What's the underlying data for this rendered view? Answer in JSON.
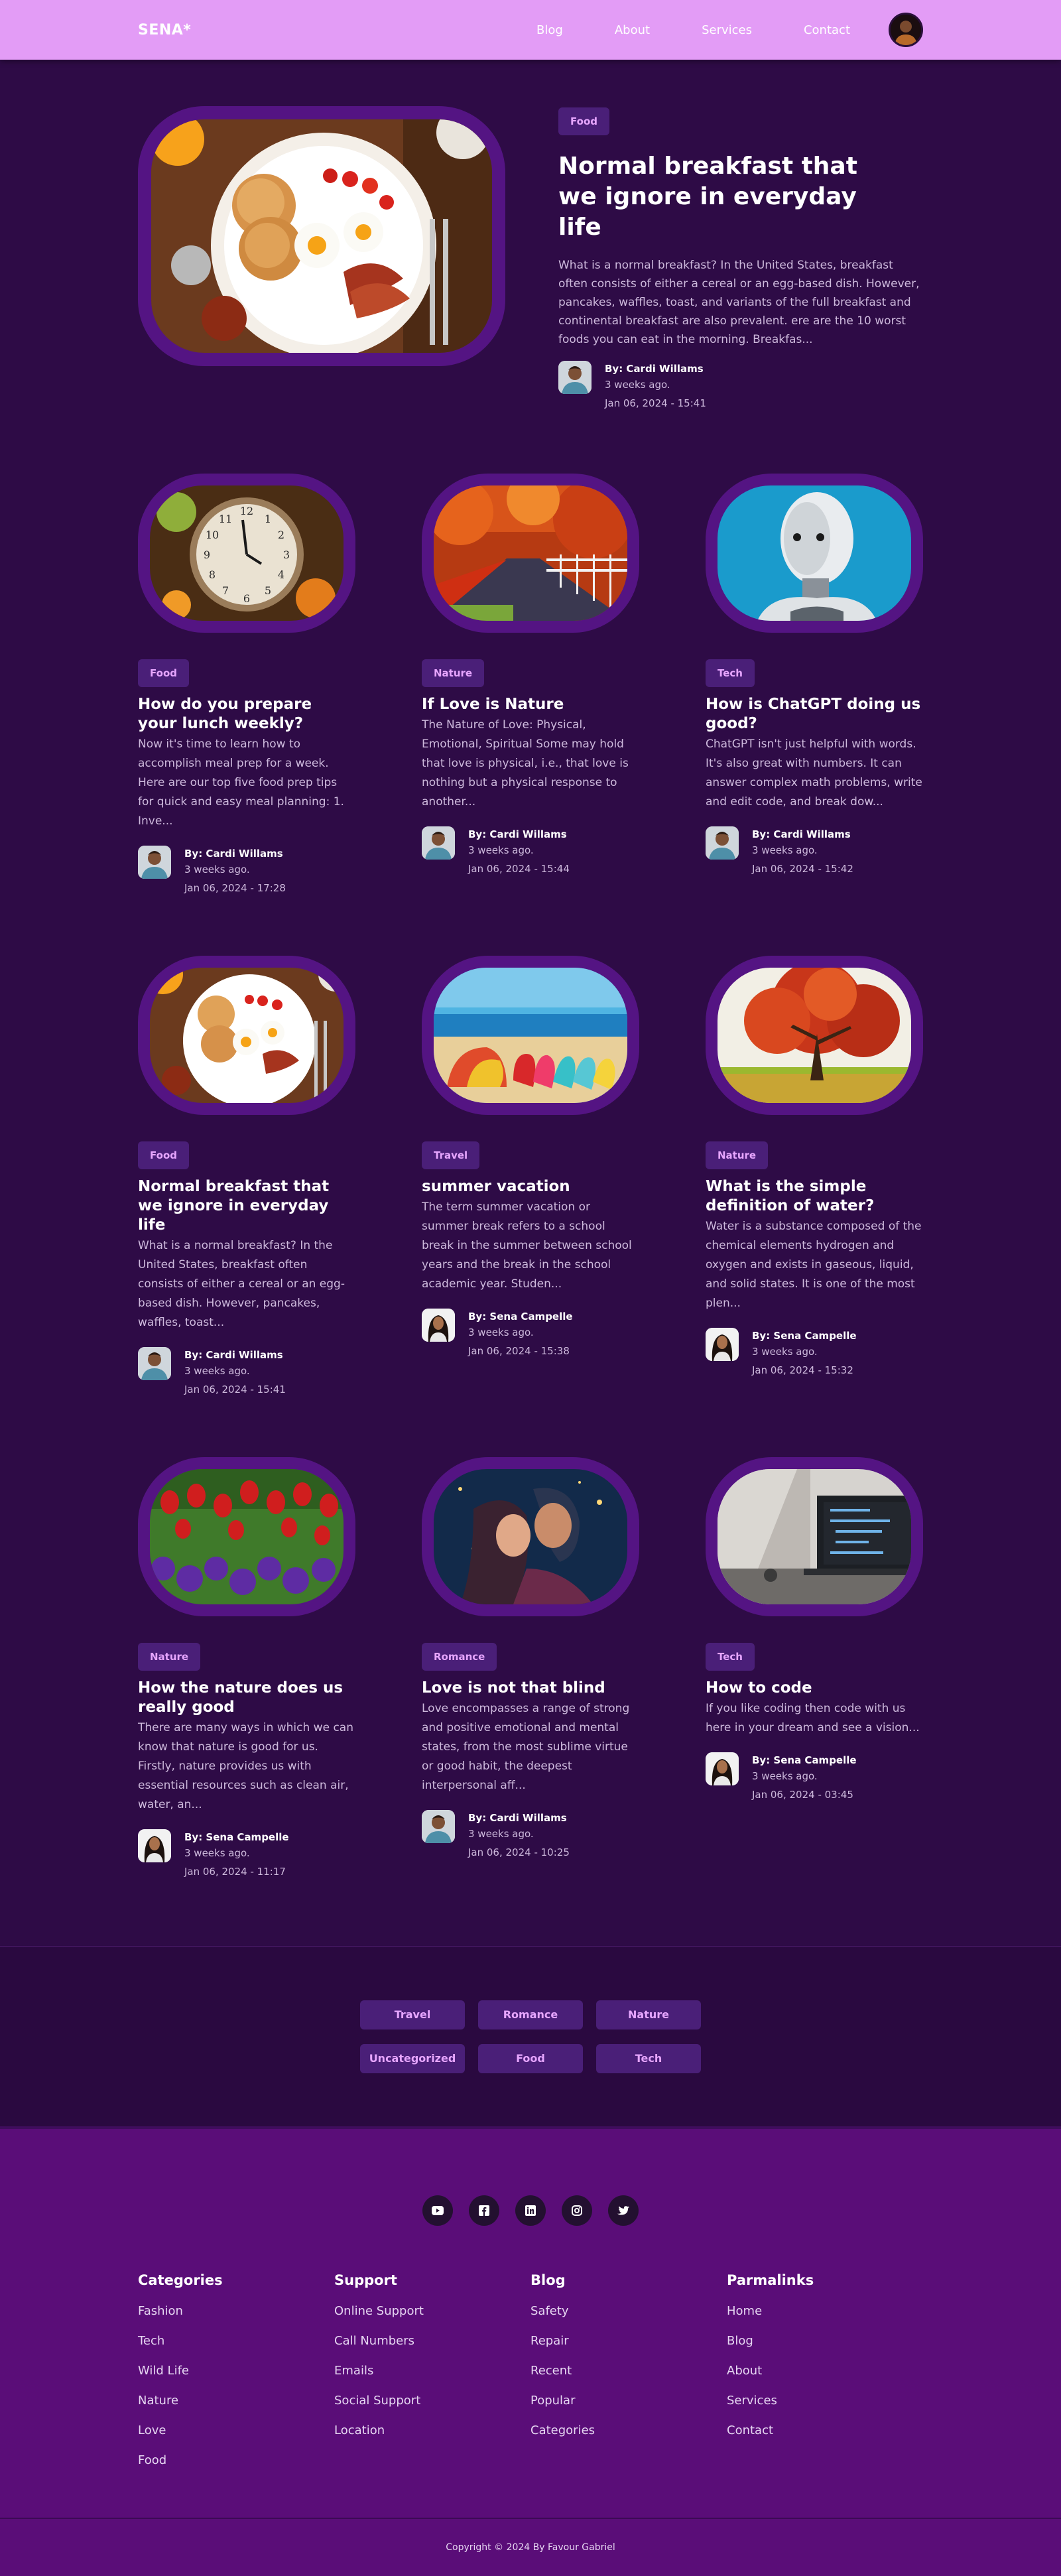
{
  "header": {
    "logo": "SENA*",
    "nav": [
      "Blog",
      "About",
      "Services",
      "Contact"
    ]
  },
  "featured": {
    "tag": "Food",
    "title": "Normal breakfast that we ignore in everyday life",
    "excerpt": "What is a normal breakfast? In the United States, breakfast often consists of either a cereal or an egg-based dish. However, pancakes, waffles, toast, and variants of the full breakfast and continental breakfast are also prevalent. ere are the 10 worst foods you can eat in the morning. Breakfas...",
    "author": "By: Cardi Willams",
    "ago": "3 weeks ago.",
    "date": "Jan 06, 2024 - 15:41"
  },
  "posts": [
    {
      "tag": "Food",
      "title": "How do you prepare your lunch weekly?",
      "excerpt": "Now it's time to learn how to accomplish meal prep for a week. Here are our top five food prep tips for quick and easy meal planning: 1. Inve...",
      "author": "By: Cardi Willams",
      "ago": "3 weeks ago.",
      "date": "Jan 06, 2024 - 17:28",
      "image": "clock-image",
      "avatar": "male"
    },
    {
      "tag": "Nature",
      "title": "If Love is Nature",
      "excerpt": "The Nature of Love: Physical, Emotional, Spiritual Some may hold that love is physical, i.e., that love is nothing but a physical response to another...",
      "author": "By: Cardi Willams",
      "ago": "3 weeks ago.",
      "date": "Jan 06, 2024 - 15:44",
      "image": "autumn-road-image",
      "avatar": "male"
    },
    {
      "tag": "Tech",
      "title": "How is ChatGPT doing us good?",
      "excerpt": "ChatGPT isn't just helpful with words. It's also great with numbers. It can answer complex math problems, write and edit code, and break dow...",
      "author": "By: Cardi Willams",
      "ago": "3 weeks ago.",
      "date": "Jan 06, 2024 - 15:42",
      "image": "robot-image",
      "avatar": "male"
    },
    {
      "tag": "Food",
      "title": "Normal breakfast that we ignore in everyday life",
      "excerpt": "What is a normal breakfast? In the United States, breakfast often consists of either a cereal or an egg-based dish. However, pancakes, waffles, toast...",
      "author": "By: Cardi Willams",
      "ago": "3 weeks ago.",
      "date": "Jan 06, 2024 - 15:41",
      "image": "breakfast-image",
      "avatar": "male"
    },
    {
      "tag": "Travel",
      "title": "summer vacation",
      "excerpt": "The term summer vacation or summer break refers to a school break in the summer between school years and the break in the school academic year. Studen...",
      "author": "By: Sena Campelle",
      "ago": "3 weeks ago.",
      "date": "Jan 06, 2024 - 15:38",
      "image": "beach-image",
      "avatar": "female"
    },
    {
      "tag": "Nature",
      "title": "What is the simple definition of water?",
      "excerpt": "Water is a substance composed of the chemical elements hydrogen and oxygen and exists in gaseous, liquid, and solid states. It is one of the most plen...",
      "author": "By: Sena Campelle",
      "ago": "3 weeks ago.",
      "date": "Jan 06, 2024 - 15:32",
      "image": "tree-image",
      "avatar": "female"
    },
    {
      "tag": "Nature",
      "title": "How the nature does us really good",
      "excerpt": "There are many ways in which we can know that nature is good for us. Firstly, nature provides us with essential resources such as clean air, water, an...",
      "author": "By: Sena Campelle",
      "ago": "3 weeks ago.",
      "date": "Jan 06, 2024 - 11:17",
      "image": "tulips-image",
      "avatar": "female"
    },
    {
      "tag": "Romance",
      "title": "Love is not that blind",
      "excerpt": "Love encompasses a range of strong and positive emotional and mental states, from the most sublime virtue or good habit, the deepest interpersonal aff...",
      "author": "By: Cardi Willams",
      "ago": "3 weeks ago.",
      "date": "Jan 06, 2024 - 10:25",
      "image": "couple-image",
      "avatar": "male"
    },
    {
      "tag": "Tech",
      "title": "How to code",
      "excerpt": "If you like coding then code with us here in your dream and see a vision...",
      "author": "By: Sena Campelle",
      "ago": "3 weeks ago.",
      "date": "Jan 06, 2024 - 03:45",
      "image": "laptop-image",
      "avatar": "female"
    }
  ],
  "tag_cloud": [
    "Travel",
    "Romance",
    "Nature",
    "Uncategorized",
    "Food",
    "Tech"
  ],
  "socials": [
    "youtube-icon",
    "facebook-icon",
    "linkedin-icon",
    "instagram-icon",
    "twitter-icon"
  ],
  "footer": {
    "columns": [
      {
        "title": "Categories",
        "links": [
          "Fashion",
          "Tech",
          "Wild Life",
          "Nature",
          "Love",
          "Food"
        ]
      },
      {
        "title": "Support",
        "links": [
          "Online Support",
          "Call Numbers",
          "Emails",
          "Social Support",
          "Location"
        ]
      },
      {
        "title": "Blog",
        "links": [
          "Safety",
          "Repair",
          "Recent",
          "Popular",
          "Categories"
        ]
      },
      {
        "title": "Parmalinks",
        "links": [
          "Home",
          "Blog",
          "About",
          "Services",
          "Contact"
        ]
      }
    ],
    "copyright": "Copyright © 2024 By Favour Gabriel"
  },
  "colors": {
    "page_bg": "#2e0b46",
    "header_bg": "#e39cf6",
    "frame": "#541483",
    "tag_bg": "#4a1f78",
    "tag_text": "#e7a6ff",
    "footer_bg": "#5a0d78"
  }
}
